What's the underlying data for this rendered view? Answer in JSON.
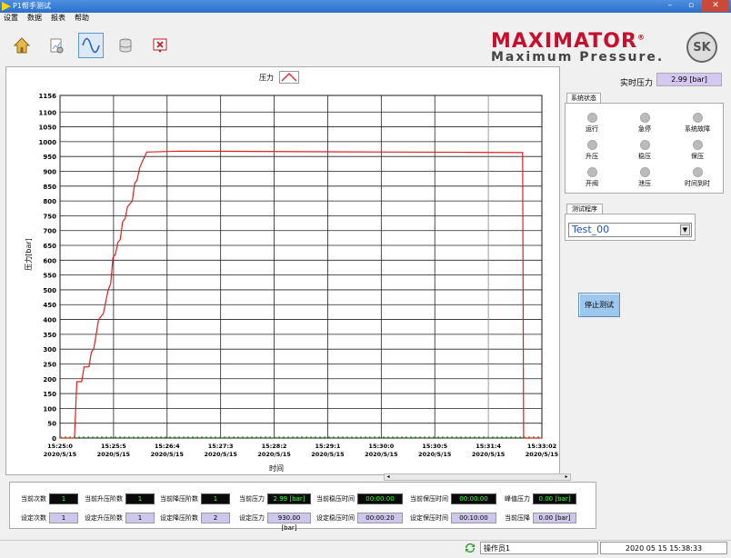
{
  "window": {
    "title": "P1帮手测试"
  },
  "menu": [
    "设置",
    "数据",
    "报表",
    "帮助"
  ],
  "toolbar": [
    {
      "name": "home-icon"
    },
    {
      "name": "settings-document-icon"
    },
    {
      "name": "waveform-icon",
      "active": true
    },
    {
      "name": "database-icon"
    },
    {
      "name": "close-report-icon"
    }
  ],
  "brand": {
    "line1": "MAXIMATOR",
    "reg": "®",
    "line2": "Maximum Pressure.",
    "badge": "SK"
  },
  "realtime": {
    "label": "实时压力",
    "value": "2.99 [bar]"
  },
  "status": {
    "tab": "系统状态",
    "leds": [
      "运行",
      "急停",
      "系统故障",
      "升压",
      "稳压",
      "保压",
      "开阀",
      "泄压",
      "时间到时"
    ]
  },
  "program": {
    "tab": "测试程序",
    "selected": "Test_00"
  },
  "stop_button": "停止测试",
  "chart_data": {
    "type": "line",
    "legend": "压力",
    "ylabel": "压力[bar]",
    "xlabel": "时间",
    "ylim": [
      0,
      1156
    ],
    "yticks": [
      0,
      50,
      100,
      150,
      200,
      250,
      300,
      350,
      400,
      450,
      500,
      550,
      600,
      650,
      700,
      750,
      800,
      850,
      900,
      950,
      1000,
      1050,
      1100,
      1156
    ],
    "xticks": [
      {
        "t": "15:25:0",
        "d": "2020/5/15"
      },
      {
        "t": "15:25:5",
        "d": "2020/5/15"
      },
      {
        "t": "15:26:4",
        "d": "2020/5/15"
      },
      {
        "t": "15:27:3",
        "d": "2020/5/15"
      },
      {
        "t": "15:28:2",
        "d": "2020/5/15"
      },
      {
        "t": "15:29:1",
        "d": "2020/5/15"
      },
      {
        "t": "15:30:0",
        "d": "2020/5/15"
      },
      {
        "t": "15:30:5",
        "d": "2020/5/15"
      },
      {
        "t": "15:31:4",
        "d": "2020/5/15"
      },
      {
        "t": "15:33:02",
        "d": "2020/5/15"
      }
    ],
    "series": [
      {
        "color": "#e02020",
        "points": [
          [
            0,
            0
          ],
          [
            0.03,
            0
          ],
          [
            0.035,
            190
          ],
          [
            0.045,
            190
          ],
          [
            0.05,
            240
          ],
          [
            0.06,
            240
          ],
          [
            0.065,
            290
          ],
          [
            0.07,
            300
          ],
          [
            0.075,
            350
          ],
          [
            0.08,
            400
          ],
          [
            0.09,
            420
          ],
          [
            0.095,
            460
          ],
          [
            0.1,
            500
          ],
          [
            0.105,
            520
          ],
          [
            0.11,
            610
          ],
          [
            0.115,
            620
          ],
          [
            0.12,
            660
          ],
          [
            0.125,
            670
          ],
          [
            0.13,
            730
          ],
          [
            0.135,
            740
          ],
          [
            0.14,
            780
          ],
          [
            0.145,
            790
          ],
          [
            0.15,
            800
          ],
          [
            0.155,
            860
          ],
          [
            0.16,
            870
          ],
          [
            0.165,
            910
          ],
          [
            0.17,
            930
          ],
          [
            0.18,
            965
          ],
          [
            0.25,
            968
          ],
          [
            0.4,
            967
          ],
          [
            0.55,
            966
          ],
          [
            0.7,
            965
          ],
          [
            0.85,
            964
          ],
          [
            0.96,
            963
          ],
          [
            0.962,
            0
          ],
          [
            1.0,
            0
          ]
        ]
      }
    ]
  },
  "bottom": {
    "row1": [
      {
        "label": "当前次数",
        "value": "1",
        "style": "dark"
      },
      {
        "label": "当前升压阶数",
        "value": "1",
        "style": "dark"
      },
      {
        "label": "当前降压阶数",
        "value": "1",
        "style": "dark"
      },
      {
        "label": "当前压力",
        "value": "2.99 [bar]",
        "style": "dark"
      },
      {
        "label": "当前稳压时间",
        "value": "00:00:00",
        "style": "dark"
      },
      {
        "label": "当前保压时间",
        "value": "00:00:00",
        "style": "dark"
      },
      {
        "label": "峰值压力",
        "value": "0.00 [bar]",
        "style": "dark"
      }
    ],
    "row2": [
      {
        "label": "设定次数",
        "value": "1",
        "style": "light"
      },
      {
        "label": "设定升压阶数",
        "value": "1",
        "style": "light"
      },
      {
        "label": "设定降压阶数",
        "value": "2",
        "style": "light"
      },
      {
        "label": "设定压力",
        "value": "930.00 [bar]",
        "style": "light"
      },
      {
        "label": "设定稳压时间",
        "value": "00:00:20",
        "style": "light"
      },
      {
        "label": "设定保压时间",
        "value": "00:10:00",
        "style": "light"
      },
      {
        "label": "当前压降",
        "value": "0.00 [bar]",
        "style": "light"
      }
    ]
  },
  "statusbar": {
    "user": "操作员1",
    "datetime": "2020 05 15 15:38:33"
  }
}
